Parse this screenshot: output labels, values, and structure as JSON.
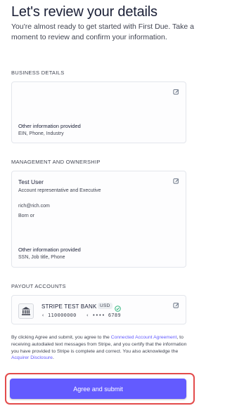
{
  "header": {
    "title": "Let's review your details",
    "subtitle": "You're almost ready to get started with First Due. Take a moment to review and confirm your information."
  },
  "business": {
    "section_label": "BUSINESS DETAILS",
    "edit_icon": "edit-icon",
    "other_info_label": "Other information provided",
    "other_info_value": "EIN, Phone, Industry"
  },
  "management": {
    "section_label": "MANAGEMENT AND OWNERSHIP",
    "person_name": "Test User",
    "person_role": "Account representative and Executive",
    "person_email": "rich@rich.com",
    "born_label": "Born or",
    "other_info_label": "Other information provided",
    "other_info_value": "SSN, Job title, Phone"
  },
  "payout": {
    "section_label": "PAYOUT ACCOUNTS",
    "bank_name": "STRIPE TEST BANK",
    "currency": "USD",
    "routing": "‹ 110000000",
    "account": "‹ •••• 6789",
    "bank_icon": "bank-icon",
    "verified_icon": "check-circle-icon"
  },
  "legal": {
    "text_1": "By clicking Agree and submit, you agree to the ",
    "link_1": "Connected Account Agreement",
    "text_2": ", to receiving autodialed text messages from Stripe, and you certify that the information you have provided to Stripe is complete and correct. You also acknowledge the ",
    "link_2": "Acquirer Disclosure",
    "text_3": "."
  },
  "actions": {
    "submit_label": "Agree and submit"
  },
  "colors": {
    "accent": "#635bff",
    "highlight": "#e34b4b",
    "verified": "#2fb67c"
  }
}
